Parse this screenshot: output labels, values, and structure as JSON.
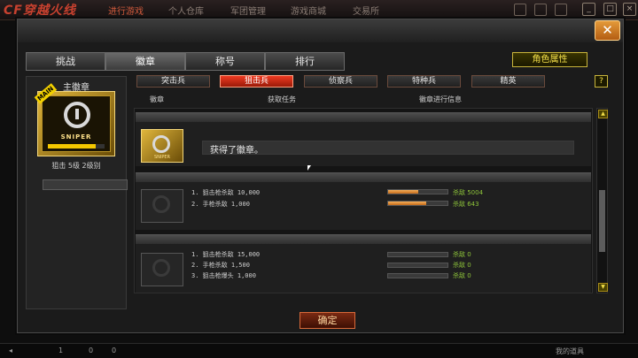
{
  "topbar": {
    "logo": "CF穿越火线",
    "nav": [
      "进行游戏",
      "个人仓库",
      "军团管理",
      "游戏商城",
      "交易所"
    ]
  },
  "window": {
    "close_label": "✕",
    "role_button": "角色属性",
    "help_label": "?"
  },
  "tabs": [
    "挑战",
    "徽章",
    "称号",
    "排行"
  ],
  "active_tab": "徽章",
  "left_panel": {
    "title": "主徽章",
    "badge_tag": "MAIN",
    "badge_caption": "SNIPER",
    "rank_text": "狙击 5级 2级别",
    "progress": 0.85
  },
  "categories": [
    "突击兵",
    "狙击兵",
    "侦察兵",
    "特种兵",
    "精英"
  ],
  "active_category": "狙击兵",
  "columns": [
    "徽章",
    "获取任务",
    "徽章进行信息"
  ],
  "rows": [
    {
      "acquired_text": "获得了徽章。",
      "badge_caption": "SNIPER"
    },
    {
      "tasks": [
        {
          "text": "1. 狙击枪杀敌 10,000",
          "kill": "杀敌 5004",
          "progress": 0.5
        },
        {
          "text": "2. 手枪杀敌 1,000",
          "kill": "杀敌 643",
          "progress": 0.64
        }
      ]
    },
    {
      "tasks": [
        {
          "text": "1. 狙击枪杀敌 15,000",
          "kill": "杀敌 0",
          "progress": 0
        },
        {
          "text": "2. 手枪杀敌 1,500",
          "kill": "杀敌 0",
          "progress": 0
        },
        {
          "text": "3. 狙击枪爆头 1,000",
          "kill": "杀敌 0",
          "progress": 0
        }
      ]
    }
  ],
  "ok_button": "确定",
  "bottombar": {
    "left_count": "1",
    "mid_counts": [
      "0",
      "0"
    ],
    "right_text": "我的道具"
  },
  "colors": {
    "accent": "#e8381e",
    "gold": "#f4e04a",
    "kill_green": "#8ec43a",
    "progress_orange": "#e08a2e"
  }
}
